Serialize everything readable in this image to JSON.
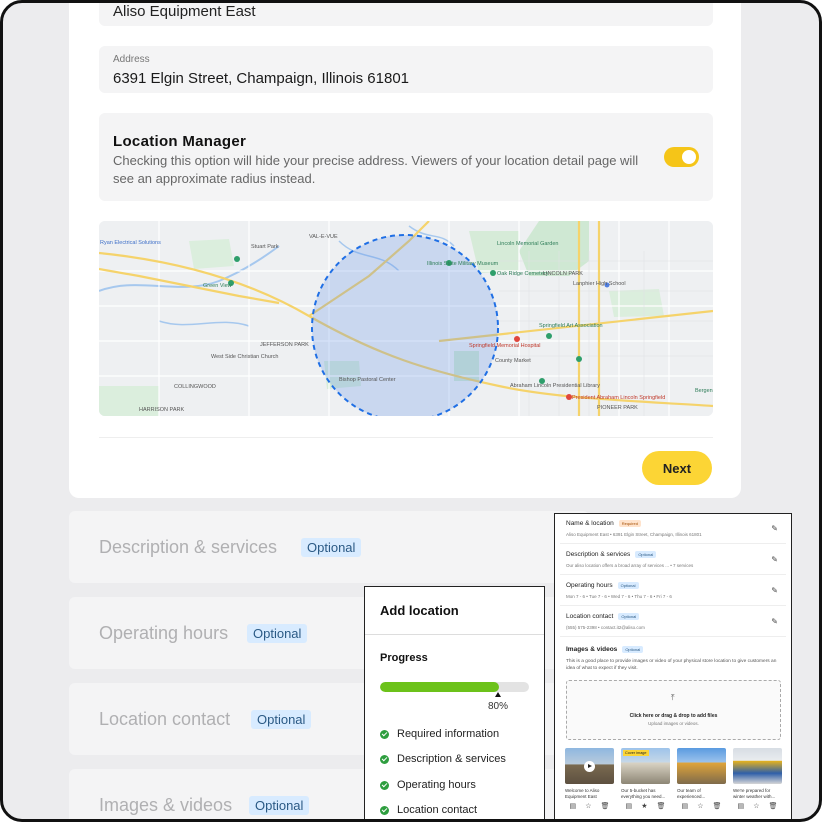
{
  "form": {
    "location_name_value": "Aliso Equipment East",
    "address_label": "Address",
    "address_value": "6391 Elgin Street, Champaign, Illinois 61801",
    "location_manager": {
      "title": "Location Manager",
      "description": "Checking this option will hide your precise address. Viewers of your location detail page will see an approximate radius instead.",
      "toggle_on": true,
      "toggle_color": "#f5c518"
    },
    "map_labels": {
      "val_e_vue": "VAL-E-VUE",
      "ryan": "Ryan Electrical Solutions",
      "stuart_park": "Stuart Park",
      "military_museum": "Illinois State Military Museum",
      "lincoln_memorial": "Lincoln Memorial Garden",
      "oak_ridge": "Oak Ridge Cemetery",
      "lincoln_park": "LINCOLN PARK",
      "lanphier": "Lanphier High School",
      "green_view": "Green View",
      "jefferson_park": "JEFFERSON PARK",
      "west_side_church": "West Side Christian Church",
      "collingwood": "COLLINGWOOD",
      "harrison_park": "HARRISON PARK",
      "springfield_art": "Springfield Art Association",
      "memorial_hospital": "Springfield Memorial Hospital",
      "county_market": "County Market",
      "pioneer_park": "PIONEER PARK",
      "abraham_library": "Abraham Lincoln Presidential Library",
      "president_lincoln": "President Abraham Lincoln Springfield",
      "bergen": "Bergen",
      "pastoral": "Bishop Pastoral Center"
    },
    "next_label": "Next",
    "accent_color": "#fcd535"
  },
  "sections": [
    {
      "title": "Description & services",
      "badge": "Optional"
    },
    {
      "title": "Operating hours",
      "badge": "Optional"
    },
    {
      "title": "Location contact",
      "badge": "Optional"
    },
    {
      "title": "Images & videos",
      "badge": "Optional"
    }
  ],
  "progress_panel": {
    "title": "Add location",
    "progress_title": "Progress",
    "progress_value": 0.8,
    "progress_label": "80%",
    "progress_color": "#6cc21a",
    "items": [
      "Required information",
      "Description & services",
      "Operating hours",
      "Location contact"
    ]
  },
  "summary_panel": {
    "rows": [
      {
        "title": "Name & location",
        "badge": "Required",
        "sub": "Aliso Equipment East • 6391 Elgin Street, Champaign, Illinois 61801"
      },
      {
        "title": "Description & services",
        "badge": "Optional",
        "sub": "Our aliso location offers a broad array of services ... • 7 services"
      },
      {
        "title": "Operating hours",
        "badge": "Optional",
        "sub": "Mon 7 - 6 • Tue 7 - 6 • Wed 7 - 6 • Thu 7 - 6 • Fri 7 - 6"
      },
      {
        "title": "Location contact",
        "badge": "Optional",
        "sub": "(555) 575-2398 • contact.it2@aliso.com"
      }
    ],
    "images": {
      "title": "Images & videos",
      "badge": "Optional",
      "description": "This is a good place to provide images or video of your physical store location to give customers an idea of what to expect if they visit.",
      "drop_title": "Click here or drag & drop to add files",
      "drop_sub": "Upload images or videos.",
      "cover_label": "Cover image",
      "thumbs": [
        {
          "caption": "Welcome to Aliso Equipment East",
          "video": true
        },
        {
          "caption": "Our 5-bucket has everything you need...",
          "cover": true
        },
        {
          "caption": "Our team of experienced...",
          "video": false
        },
        {
          "caption": "We're prepared for winter weather with...",
          "video": false
        }
      ]
    }
  }
}
